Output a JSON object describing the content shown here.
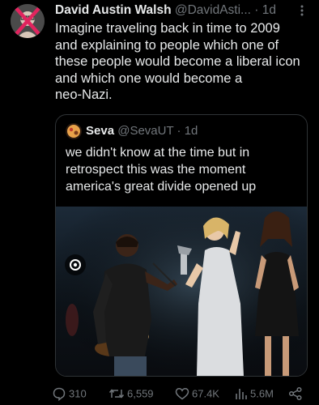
{
  "post": {
    "author_name": "David Austin Walsh",
    "author_handle": "@DavidAsti...",
    "separator": "·",
    "time": "1d",
    "text_lines": [
      "Imagine traveling back in time to 2009",
      "and explaining to people which one of",
      "these people would become a liberal icon",
      "and which one would become a",
      "neo-Nazi."
    ]
  },
  "quote": {
    "author_name": "Seva",
    "author_handle": "@SevaUT",
    "separator": "·",
    "time": "1d",
    "text_lines": [
      "we didn't know at the time but in",
      "retrospect this was the moment",
      "america's great divide opened up"
    ]
  },
  "actions": {
    "replies": "310",
    "reposts": "6,559",
    "likes": "67.4K",
    "views": "5.6M"
  },
  "icons": {
    "more": "more-icon",
    "reply": "reply-icon",
    "repost": "repost-icon",
    "like": "heart-icon",
    "views": "views-icon",
    "share": "share-icon",
    "image_badge": "image-badge-icon"
  },
  "colors": {
    "background": "#000000",
    "text": "#e7e9ea",
    "muted": "#71767b",
    "border": "#2f3336",
    "avatar_cross": "#e0245e"
  }
}
